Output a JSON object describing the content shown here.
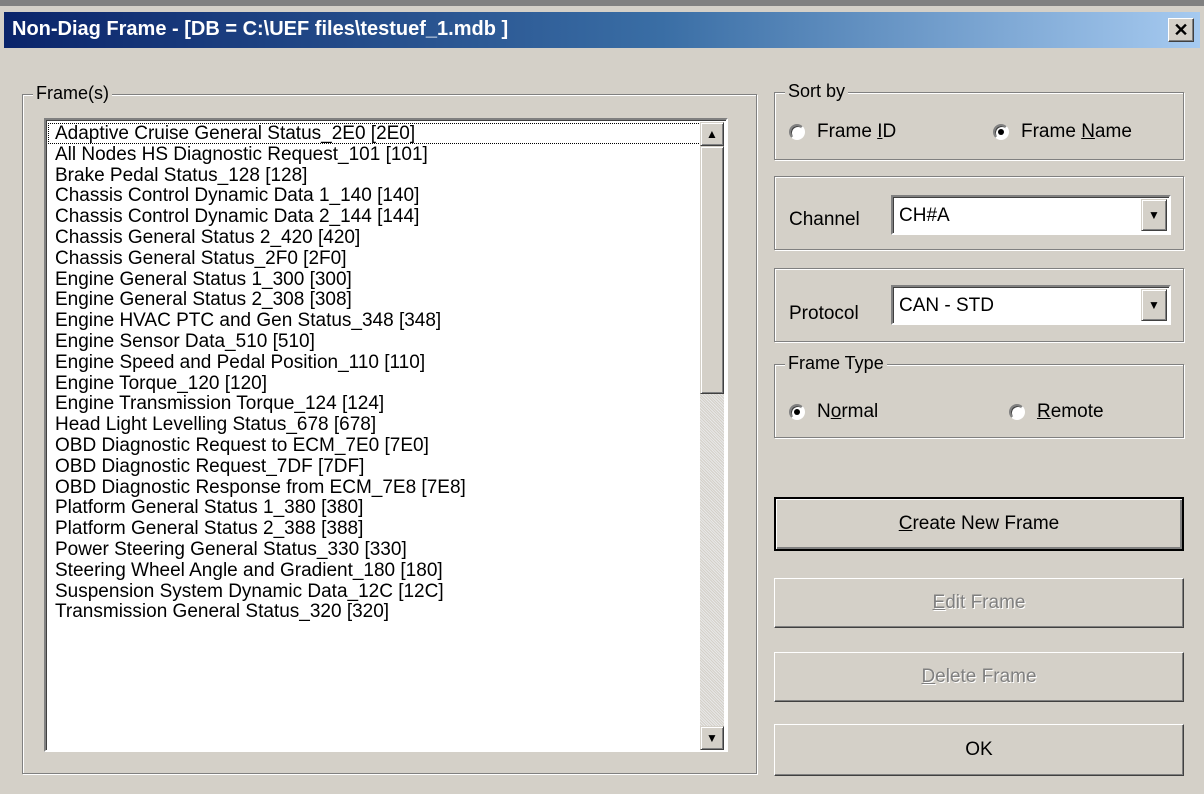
{
  "window": {
    "title": "Non-Diag Frame - [DB = C:\\UEF files\\testuef_1.mdb ]",
    "close_glyph": "✕"
  },
  "frames": {
    "label": "Frame(s)",
    "items": [
      "Adaptive Cruise General Status_2E0 [2E0]",
      "All Nodes HS Diagnostic Request_101 [101]",
      "Brake Pedal Status_128 [128]",
      "Chassis Control Dynamic Data 1_140 [140]",
      "Chassis Control Dynamic Data 2_144 [144]",
      "Chassis General Status 2_420 [420]",
      "Chassis General Status_2F0 [2F0]",
      "Engine General Status 1_300 [300]",
      "Engine General Status 2_308 [308]",
      "Engine HVAC PTC and Gen Status_348 [348]",
      "Engine Sensor Data_510 [510]",
      "Engine Speed and Pedal Position_110 [110]",
      "Engine Torque_120 [120]",
      "Engine Transmission Torque_124 [124]",
      "Head Light Levelling Status_678 [678]",
      "OBD Diagnostic Request to ECM_7E0 [7E0]",
      "OBD Diagnostic Request_7DF [7DF]",
      "OBD Diagnostic Response from ECM_7E8 [7E8]",
      "Platform General Status 1_380 [380]",
      "Platform General Status 2_388 [388]",
      "Power Steering General Status_330 [330]",
      "Steering Wheel Angle and Gradient_180 [180]",
      "Suspension System Dynamic Data_12C [12C]",
      "Transmission General Status_320 [320]"
    ]
  },
  "sort_by": {
    "label": "Sort by",
    "frame_id_pre": "Frame ",
    "frame_id_ul": "I",
    "frame_id_post": "D",
    "frame_name_pre": "Frame ",
    "frame_name_ul": "N",
    "frame_name_post": "ame",
    "selected": "Frame Name"
  },
  "channel": {
    "label": "Channel",
    "value": "CH#A"
  },
  "protocol": {
    "label": "Protocol",
    "value": "CAN - STD"
  },
  "frame_type": {
    "label": "Frame Type",
    "normal_pre": "N",
    "normal_ul": "o",
    "normal_post": "rmal",
    "remote_ul": "R",
    "remote_post": "emote",
    "selected": "Normal"
  },
  "buttons": {
    "create_ul": "C",
    "create_post": "reate New Frame",
    "edit_ul": "E",
    "edit_post": "dit Frame",
    "delete_ul": "D",
    "delete_post": "elete Frame",
    "ok": "OK"
  },
  "colors": {
    "titlebar_start": "#0a246a",
    "titlebar_end": "#a6caf0",
    "dialog_face": "#d4d0c8"
  }
}
